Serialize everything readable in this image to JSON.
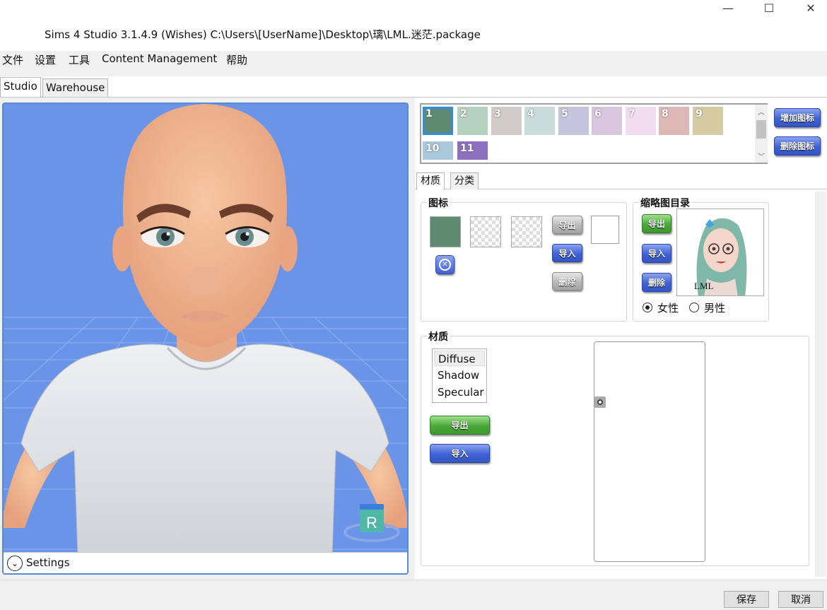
{
  "window": {
    "title": "Sims 4 Studio 3.1.4.9 (Wishes)  C:\\Users\\[UserName]\\Desktop\\璃\\LML.迷茫.package",
    "minimize_glyph": "—",
    "maximize_glyph": "☐",
    "close_glyph": "✕"
  },
  "menu": {
    "items": [
      "文件",
      "设置",
      "工具",
      "Content Management",
      "帮助"
    ]
  },
  "main_tabs": [
    "Studio",
    "Warehouse"
  ],
  "viewport": {
    "settings_label": "Settings",
    "logo_letter": "R",
    "expand_icon": "chevron-down-icon"
  },
  "swatches": [
    {
      "label": "1",
      "color": "#5f8a72"
    },
    {
      "label": "2",
      "color": "#b5d1c0"
    },
    {
      "label": "3",
      "color": "#d3cbc8"
    },
    {
      "label": "4",
      "color": "#c9dcdc"
    },
    {
      "label": "5",
      "color": "#c3c6dc"
    },
    {
      "label": "6",
      "color": "#d8c6de"
    },
    {
      "label": "7",
      "color": "#f2dcf0"
    },
    {
      "label": "8",
      "color": "#deb7b7"
    },
    {
      "label": "9",
      "color": "#d7cba4"
    },
    {
      "label": "10",
      "color": "#a9c8dc"
    },
    {
      "label": "11",
      "color": "#8c6fbe"
    }
  ],
  "swatch_buttons": {
    "add": "增加图标",
    "delete": "删除图标"
  },
  "inner_tabs": [
    "材质",
    "分类"
  ],
  "icon_group": {
    "title": "图标",
    "export": "导出",
    "import": "导入",
    "delete": "删除",
    "selected_color": "#5f8a72"
  },
  "thumb_group": {
    "title": "缩略图目录",
    "export": "导出",
    "import": "导入",
    "delete": "删除",
    "thumb_caption": "LML",
    "gender_female": "女性",
    "gender_male": "男性",
    "selected_gender": "女性"
  },
  "material_group": {
    "title": "材质",
    "items": [
      "Diffuse",
      "Shadow",
      "Specular"
    ],
    "selected": "Diffuse",
    "export": "导出",
    "import": "导入"
  },
  "dialog": {
    "save": "保存",
    "cancel": "取消"
  }
}
